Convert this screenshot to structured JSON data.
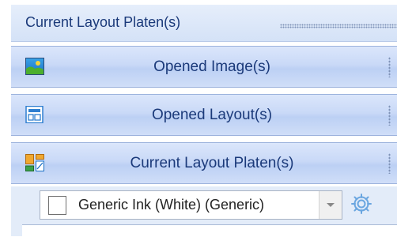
{
  "header": {
    "title": "Current Layout Platen(s)"
  },
  "sections": [
    {
      "label": "Opened Image(s)",
      "icon": "image-icon"
    },
    {
      "label": "Opened Layout(s)",
      "icon": "layout-icon"
    },
    {
      "label": "Current Layout Platen(s)",
      "icon": "platen-layout-icon"
    }
  ],
  "ink": {
    "selected": "Generic Ink (White) (Generic)",
    "swatch_color": "#ffffff"
  },
  "colors": {
    "accent_text": "#1b3a7a",
    "header_bg": "#d4e2f7",
    "settings_icon": "#6aa6e0"
  }
}
